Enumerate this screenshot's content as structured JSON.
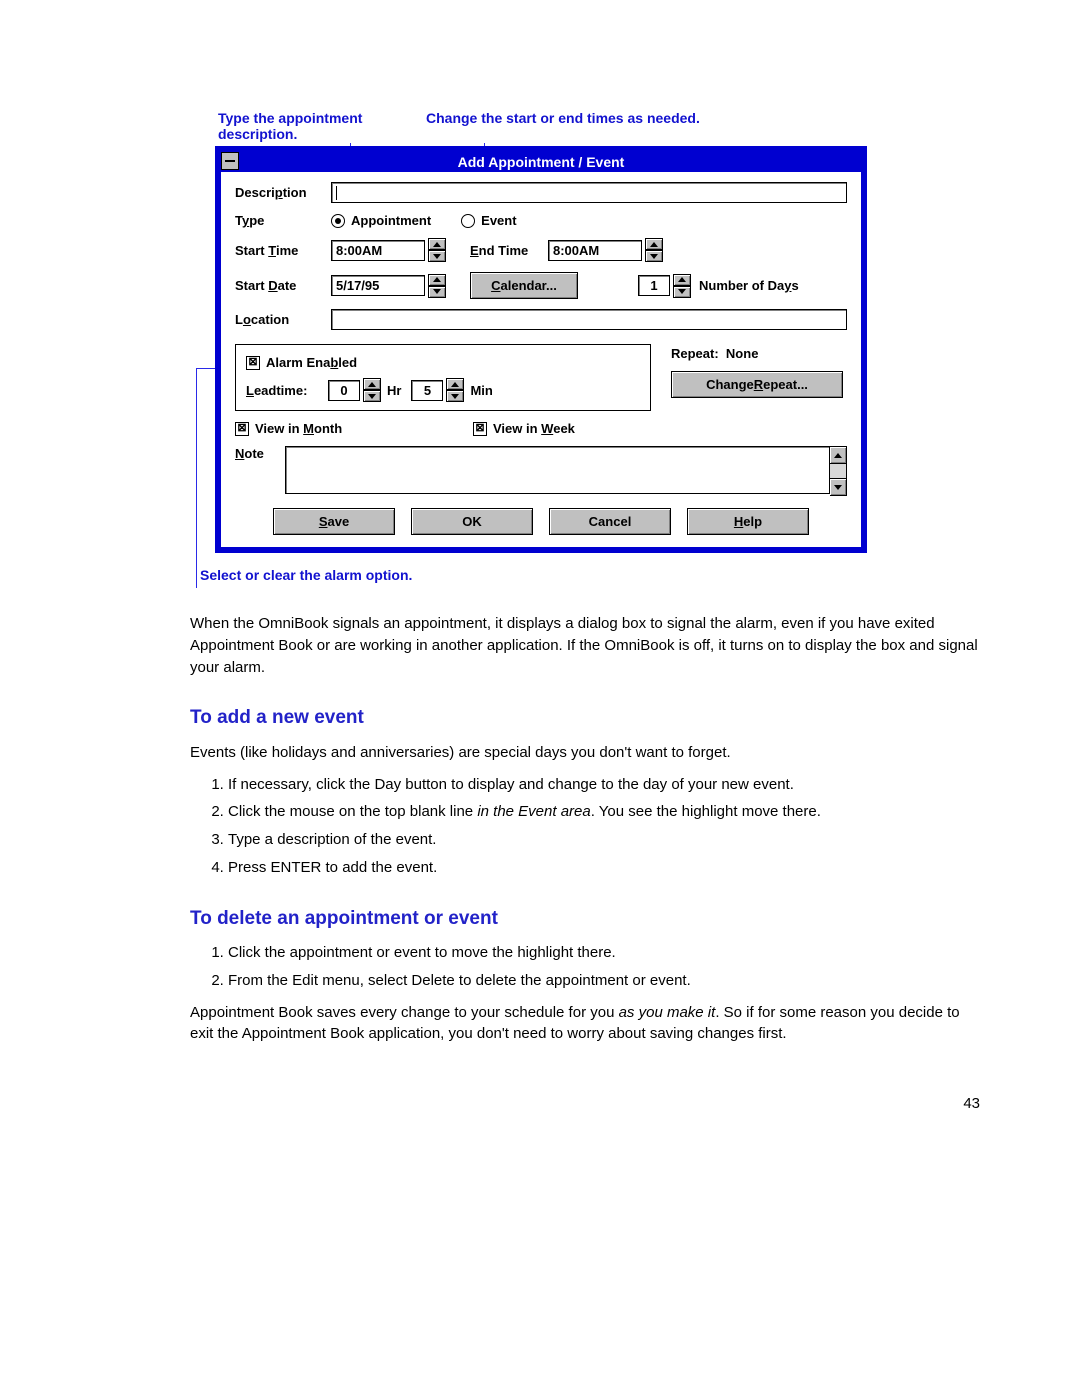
{
  "callouts": {
    "top1": "Type the appointment description.",
    "top2": "Change the start or end times as needed.",
    "bottom": "Select or clear the alarm option."
  },
  "dialog": {
    "title": "Add Appointment / Event",
    "labels": {
      "description": "Description",
      "type": "Type",
      "start_time": "Start Time",
      "end_time": "End Time",
      "start_date": "Start Date",
      "calendar_btn": "Calendar...",
      "number_of_days": "Number of Days",
      "location": "Location",
      "alarm_enabled": "Alarm Enabled",
      "leadtime": "Leadtime:",
      "hr": "Hr",
      "min": "Min",
      "repeat": "Repeat:",
      "repeat_value": "None",
      "change_repeat": "Change Repeat...",
      "view_month": "View in Month",
      "view_week": "View in Week",
      "note": "Note",
      "save": "Save",
      "ok": "OK",
      "cancel": "Cancel",
      "help": "Help"
    },
    "radios": {
      "appointment": "Appointment",
      "event": "Event"
    },
    "values": {
      "description": "",
      "start_time": "8:00AM",
      "end_time": "8:00AM",
      "start_date": "5/17/95",
      "num_days": "1",
      "lead_hr": "0",
      "lead_min": "5",
      "alarm_on": true,
      "view_month_on": true,
      "view_week_on": true
    }
  },
  "body": {
    "para1": "When the OmniBook signals an appointment, it displays a dialog box to signal the alarm, even if you have exited Appointment Book or are working in another application. If the OmniBook is off, it turns on to display the box and signal your alarm.",
    "h1": "To add a new event",
    "para2": "Events (like holidays and anniversaries) are special days you don't want to forget.",
    "steps1": [
      "If necessary, click the Day button to display and change to the day of your new event.",
      "Click the mouse on the top blank line in the Event area. You see the highlight move there.",
      "Type a description of the event.",
      "Press ENTER to add the event."
    ],
    "h2": "To delete an appointment or event",
    "steps2": [
      "Click the appointment or event to move the highlight there.",
      "From the Edit menu, select Delete to delete the appointment or event."
    ],
    "para3": "Appointment Book saves every change to your schedule for you as you make it. So if for some reason you decide to exit the Appointment Book application, you don't need to worry about saving changes first.",
    "page_number": "43"
  }
}
